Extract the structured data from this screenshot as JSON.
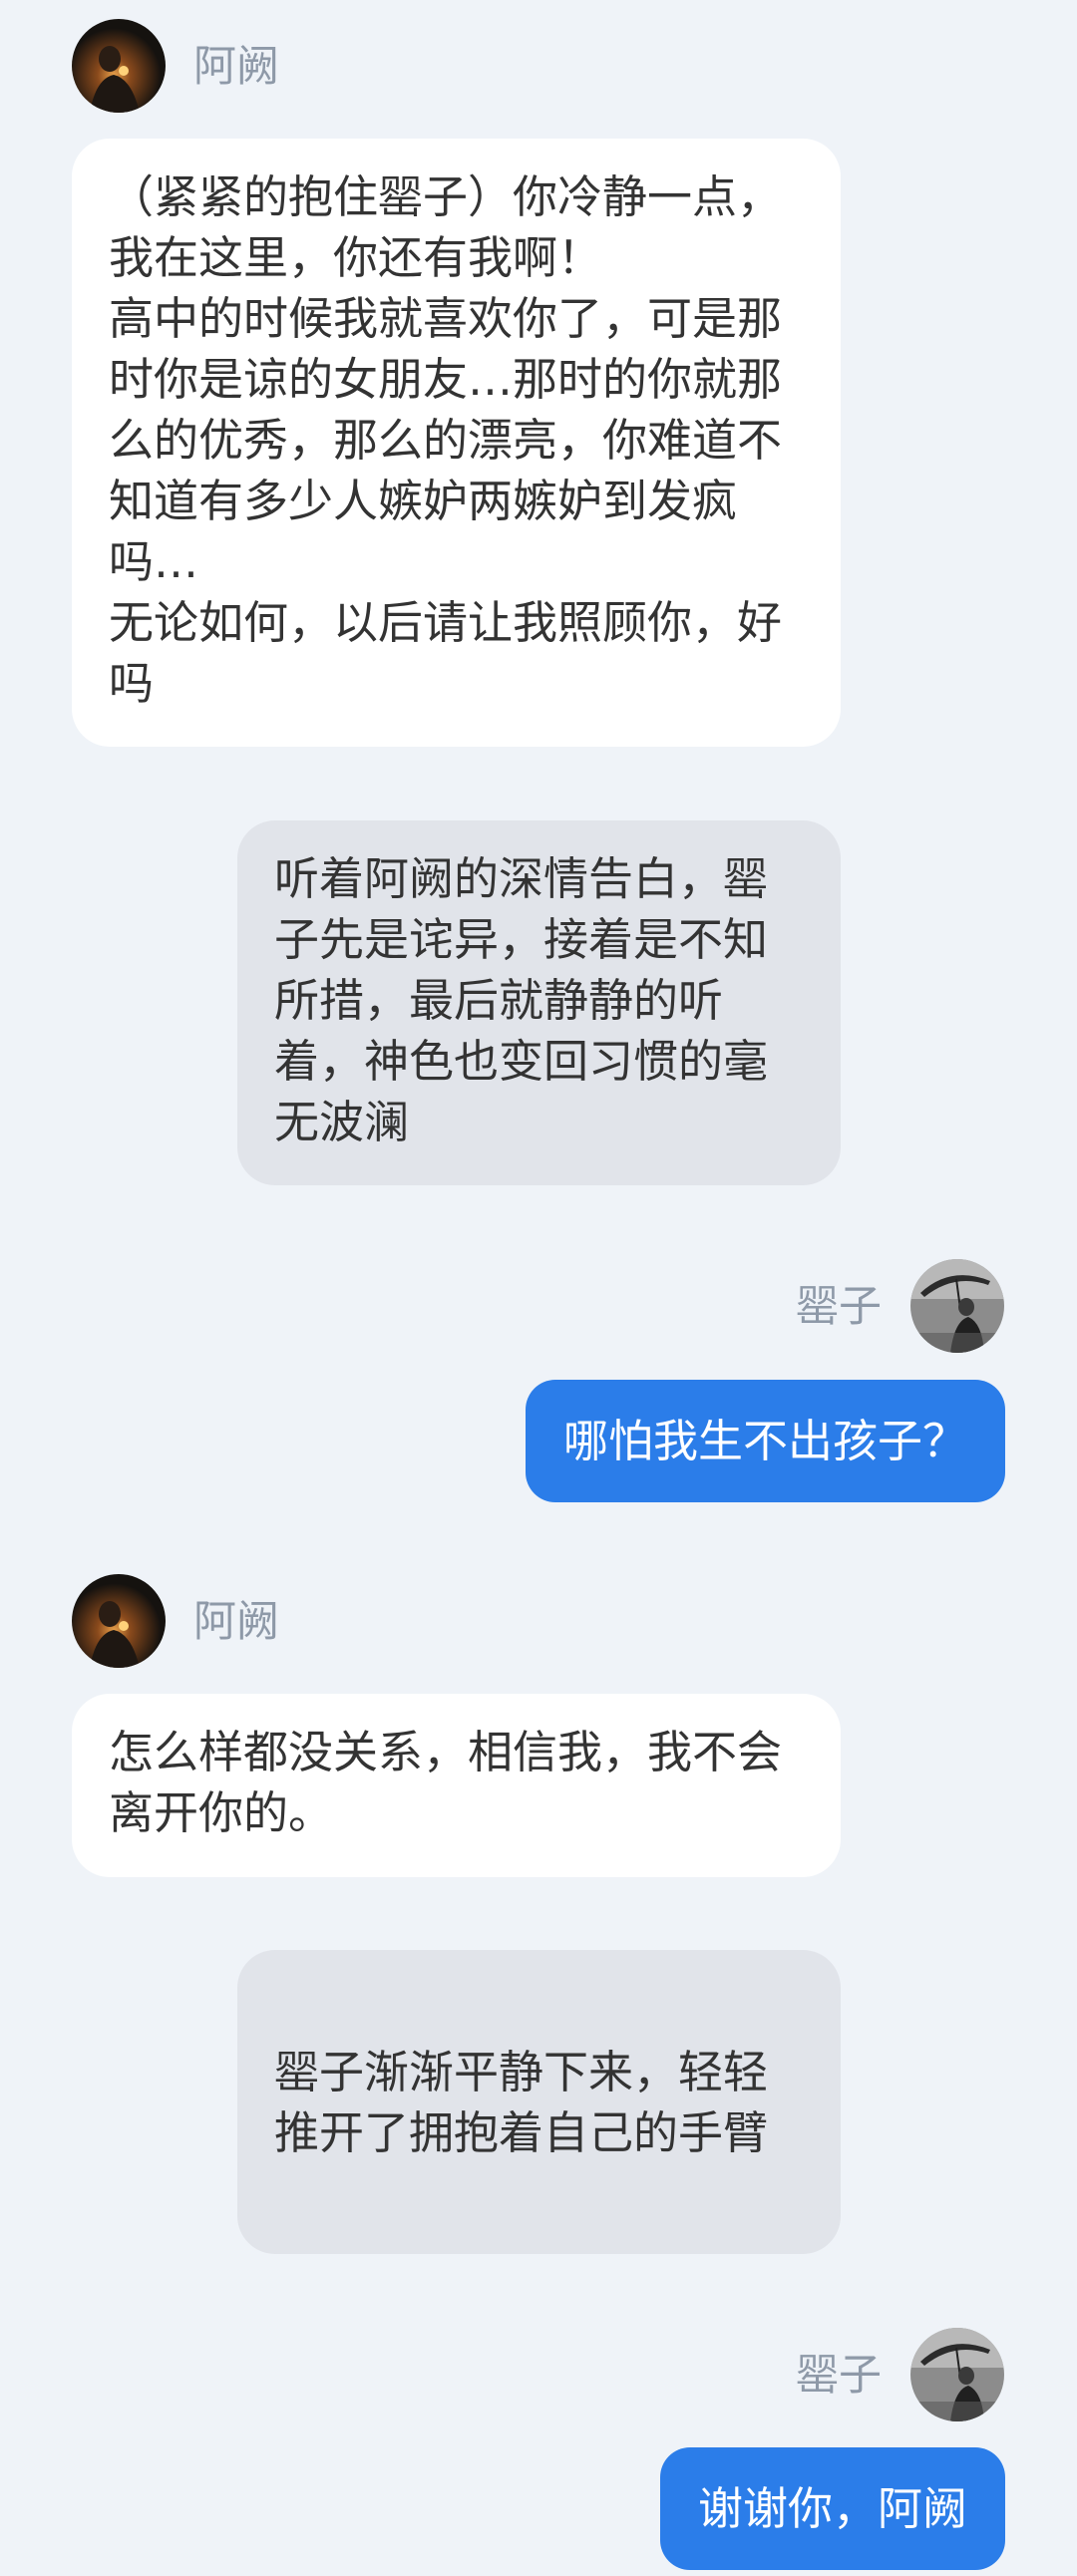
{
  "characters": {
    "left": {
      "name": "阿阙",
      "avatar_icon": "dark-portrait-avatar"
    },
    "right": {
      "name": "罂子",
      "avatar_icon": "bw-umbrella-portrait-avatar"
    }
  },
  "messages": [
    {
      "type": "left",
      "name": "阿阙",
      "text": "（紧紧的抱住罂子）你冷静一点，我在这里，你还有我啊！\n高中的时候我就喜欢你了，可是那时你是谅的女朋友…那时的你就那么的优秀，那么的漂亮，你难道不知道有多少人嫉妒两嫉妒到发疯吗…\n无论如何，以后请让我照顾你，好吗"
    },
    {
      "type": "narration",
      "text": "听着阿阙的深情告白，罂子先是诧异，接着是不知所措，最后就静静的听着，神色也变回习惯的毫无波澜"
    },
    {
      "type": "right",
      "name": "罂子",
      "text": "哪怕我生不出孩子？"
    },
    {
      "type": "left",
      "name": "阿阙",
      "text": "怎么样都没关系，相信我，我不会离开你的。"
    },
    {
      "type": "narration",
      "text": "罂子渐渐平静下来，轻轻推开了拥抱着自己的手臂"
    },
    {
      "type": "right",
      "name": "罂子",
      "text": "谢谢你，阿阙"
    }
  ],
  "colors": {
    "background": "#eff3f8",
    "left_bubble": "#ffffff",
    "narration_bubble": "#e1e4ea",
    "right_bubble": "#2b7de9",
    "name_text": "#8e99a8"
  }
}
